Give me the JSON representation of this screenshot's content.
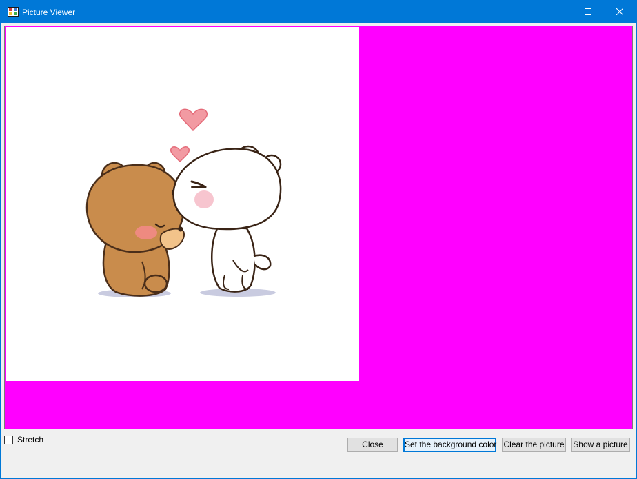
{
  "window": {
    "title": "Picture Viewer",
    "accent_color": "#0078d7",
    "controls": [
      "minimize-icon",
      "maximize-icon",
      "close-icon"
    ]
  },
  "picture_box": {
    "background_color": "#ff00ff",
    "image_background": "#ffffff",
    "image_description_icon": "bears-hug-image"
  },
  "options": {
    "stretch_label": "Stretch",
    "stretch_checked": false
  },
  "buttons": {
    "close_label": "Close",
    "background_label": "Set the background color",
    "clear_label": "Clear the picture",
    "show_label": "Show a picture"
  }
}
